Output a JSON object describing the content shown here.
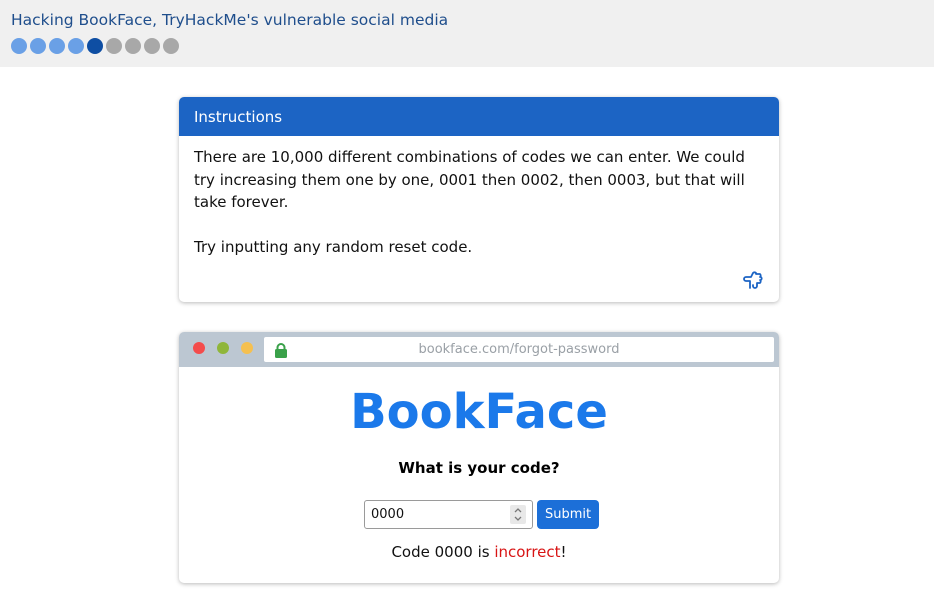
{
  "topbar": {
    "title": "Hacking BookFace, TryHackMe's vulnerable social media",
    "progress": {
      "total_steps": 9,
      "completed_steps": 4,
      "current_step": 5
    }
  },
  "instructions": {
    "header": "Instructions",
    "paragraphs": [
      "There are 10,000 different combinations of codes we can enter. We could try increasing them one by one, 0001 then 0002, then 0003, but that will take forever.",
      "Try inputting any random reset code."
    ],
    "hint_icon": "hint-pointer-icon"
  },
  "browser": {
    "url": "bookface.com/forgot-password",
    "lock_icon": "lock-icon"
  },
  "bookface": {
    "logo": "BookFace",
    "question": "What is your code?",
    "code_value": "0000",
    "submit_label": "Submit",
    "result": {
      "prefix": "Code 0000 is ",
      "status": "incorrect",
      "suffix": "!"
    }
  },
  "colors": {
    "accent": "#1c64c4",
    "logo": "#1b79ea",
    "error": "#d81414",
    "progress_done": "#6aa0e6",
    "progress_current": "#0e4ea3",
    "progress_todo": "#a8a8a8"
  }
}
